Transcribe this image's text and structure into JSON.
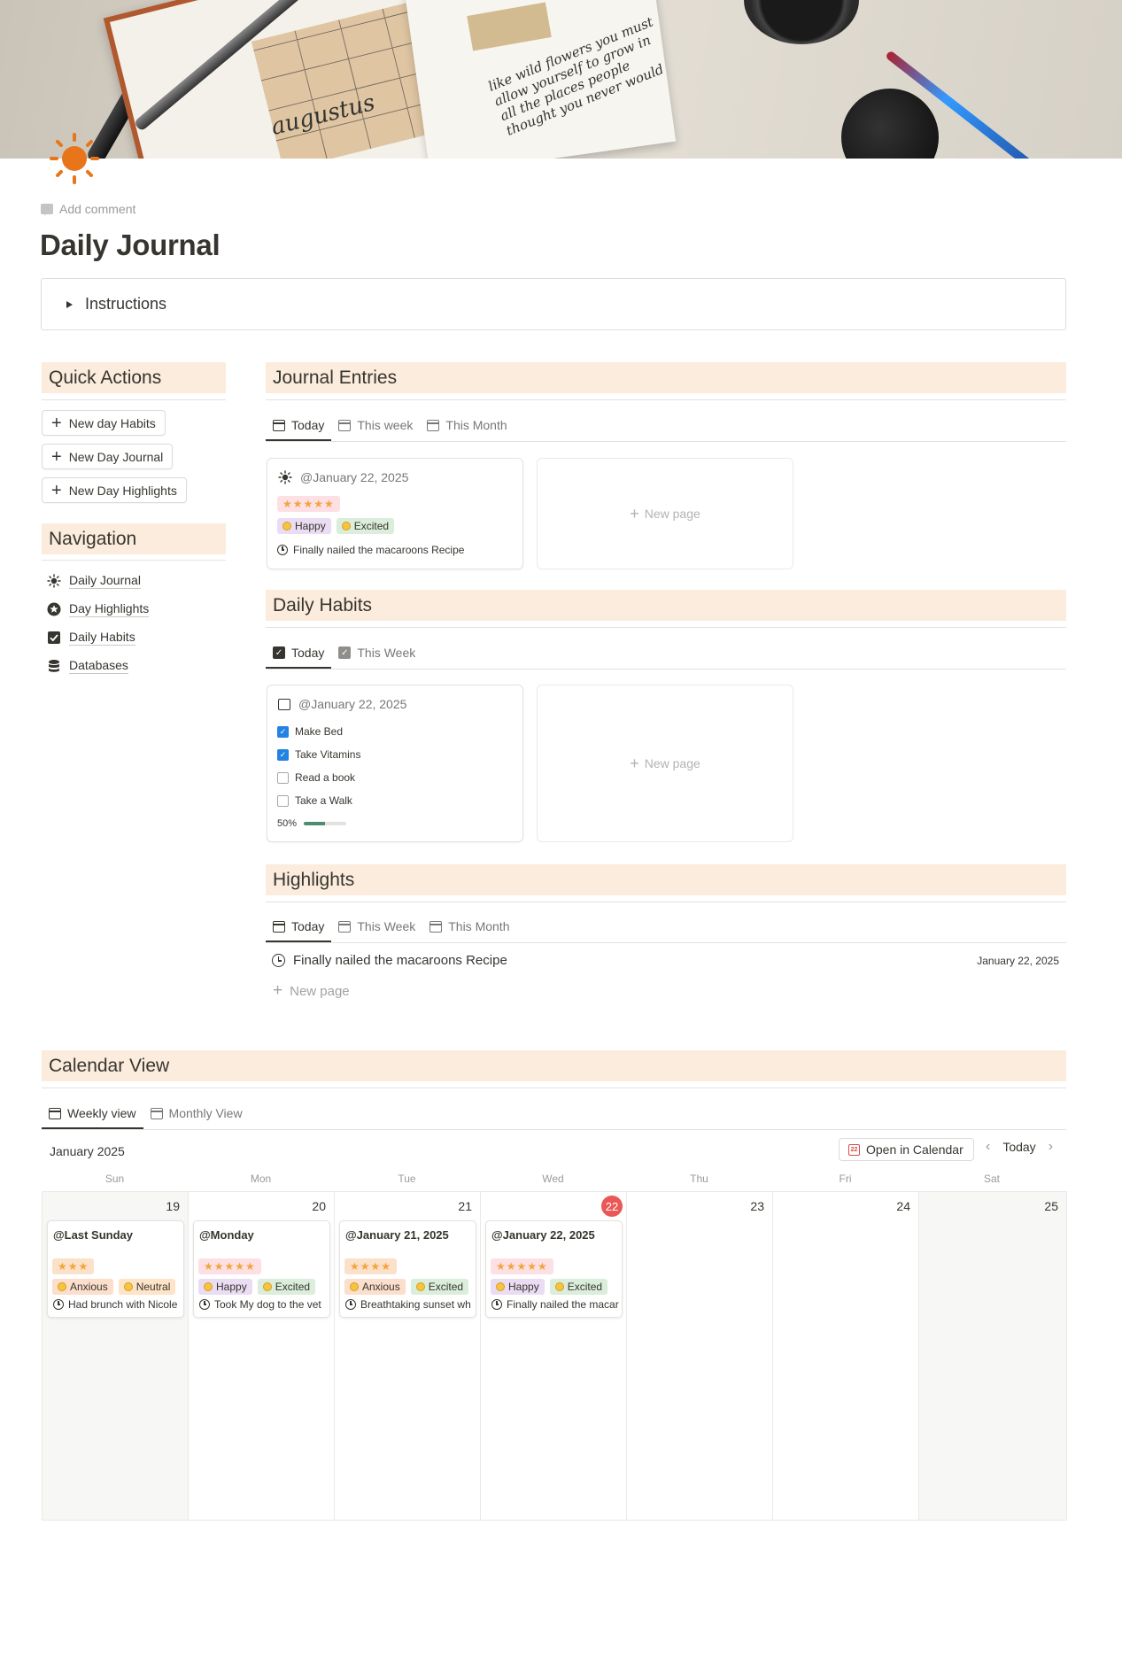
{
  "cover": {
    "script_text": "like wild flowers you must allow yourself to grow in all the places people thought you never would",
    "month_word": "augustus"
  },
  "page": {
    "add_comment": "Add comment",
    "title": "Daily Journal",
    "instructions_label": "Instructions"
  },
  "quick_actions": {
    "heading": "Quick Actions",
    "buttons": [
      "New day Habits",
      "New Day Journal",
      "New Day Highlights"
    ]
  },
  "navigation": {
    "heading": "Navigation",
    "items": [
      {
        "label": "Daily Journal",
        "icon": "sun-icon"
      },
      {
        "label": "Day Highlights",
        "icon": "star-icon"
      },
      {
        "label": "Daily Habits",
        "icon": "checkbox-icon"
      },
      {
        "label": "Databases",
        "icon": "database-icon"
      }
    ]
  },
  "journal_entries": {
    "heading": "Journal Entries",
    "tabs": [
      "Today",
      "This week",
      "This Month"
    ],
    "card": {
      "date": "@January 22, 2025",
      "stars": "★★★★★",
      "tags": [
        "Happy",
        "Excited"
      ],
      "note": "Finally nailed the macaroons Recipe"
    },
    "new_page": "New page"
  },
  "daily_habits": {
    "heading": "Daily Habits",
    "tabs": [
      "Today",
      "This Week"
    ],
    "card": {
      "date": "@January 22, 2025",
      "items": [
        {
          "label": "Make Bed",
          "checked": true
        },
        {
          "label": "Take Vitamins",
          "checked": true
        },
        {
          "label": "Read a book",
          "checked": false
        },
        {
          "label": "Take a Walk",
          "checked": false
        }
      ],
      "progress_label": "50%",
      "progress_fraction": 0.5
    },
    "new_page": "New page"
  },
  "highlights": {
    "heading": "Highlights",
    "tabs": [
      "Today",
      "This Week",
      "This Month"
    ],
    "rows": [
      {
        "title": "Finally nailed the macaroons Recipe",
        "date": "January 22, 2025"
      }
    ],
    "new_page": "New page"
  },
  "calendar": {
    "heading": "Calendar View",
    "tabs": [
      "Weekly view",
      "Monthly View"
    ],
    "month": "January 2025",
    "open_in_calendar": "Open in Calendar",
    "today_button": "Today",
    "days_of_week": [
      "Sun",
      "Mon",
      "Tue",
      "Wed",
      "Thu",
      "Fri",
      "Sat"
    ],
    "days": [
      {
        "num": "19",
        "entry": {
          "title": "@Last Sunday",
          "stars": "★★★",
          "tags": [
            {
              "label": "Anxious",
              "kind": "anxious"
            },
            {
              "label": "Neutral",
              "kind": "neutral"
            }
          ],
          "note": "Had brunch with Nicole"
        }
      },
      {
        "num": "20",
        "entry": {
          "title": "@Monday",
          "stars": "★★★★★",
          "tags": [
            {
              "label": "Happy",
              "kind": "happy"
            },
            {
              "label": "Excited",
              "kind": "excited"
            }
          ],
          "note": "Took My dog to the vet"
        }
      },
      {
        "num": "21",
        "entry": {
          "title": "@January 21, 2025",
          "stars": "★★★★",
          "tags": [
            {
              "label": "Anxious",
              "kind": "anxious"
            },
            {
              "label": "Excited",
              "kind": "excited"
            }
          ],
          "note": "Breathtaking sunset wh"
        }
      },
      {
        "num": "22",
        "today": true,
        "entry": {
          "title": "@January 22, 2025",
          "stars": "★★★★★",
          "tags": [
            {
              "label": "Happy",
              "kind": "happy"
            },
            {
              "label": "Excited",
              "kind": "excited"
            }
          ],
          "note": "Finally nailed the macar"
        }
      },
      {
        "num": "23"
      },
      {
        "num": "24"
      },
      {
        "num": "25"
      }
    ]
  },
  "colors": {
    "section_bg": "#fbecdd",
    "today_badge": "#eb5757",
    "checkbox_on": "#2383e2",
    "star": "#f2a53c",
    "sun": "#e8751a"
  }
}
